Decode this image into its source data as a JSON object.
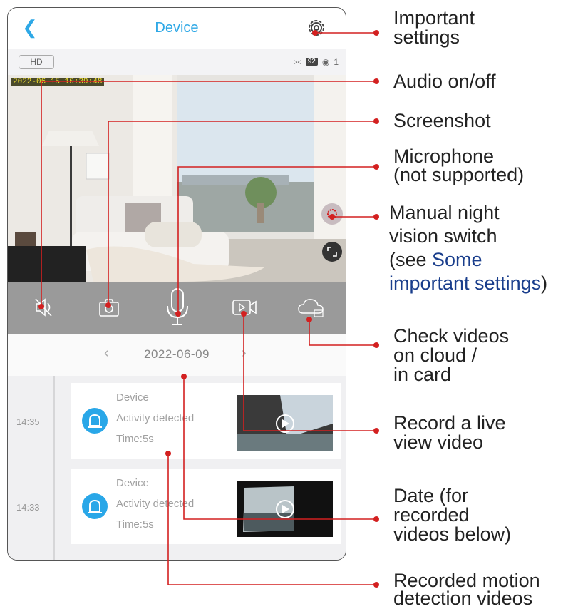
{
  "header": {
    "title": "Device",
    "back_icon": "chevron-left-icon",
    "settings_icon": "gear-icon"
  },
  "status": {
    "quality": "HD",
    "battery": "92",
    "viewers": "1"
  },
  "video": {
    "timestamp": "2022-06-15  10:39:48"
  },
  "datebar": {
    "date": "2022-06-09"
  },
  "events": [
    {
      "time": "14:35",
      "device": "Device",
      "activity": "Activity detected",
      "duration": "Time:5s"
    },
    {
      "time": "14:33",
      "device": "Device",
      "activity": "Activity detected",
      "duration": "Time:5s"
    }
  ],
  "annotations": {
    "settings": [
      "Important",
      "settings"
    ],
    "audio": "Audio on/off",
    "screenshot": "Screenshot",
    "microphone": [
      "Microphone",
      "(not supported)"
    ],
    "night_vision": [
      "Manual night",
      "vision switch",
      "(see ",
      "Some",
      "important settings",
      ")"
    ],
    "cloud": [
      "Check videos",
      "on cloud /",
      "in card"
    ],
    "record": [
      "Record a live",
      "view video"
    ],
    "date": [
      "Date (for",
      "recorded",
      "videos below)"
    ],
    "motion": [
      "Recorded motion",
      "detection videos"
    ]
  },
  "colors": {
    "accent": "#2ea8e6",
    "annotation_line": "#d32020",
    "link": "#1a3e8c"
  }
}
